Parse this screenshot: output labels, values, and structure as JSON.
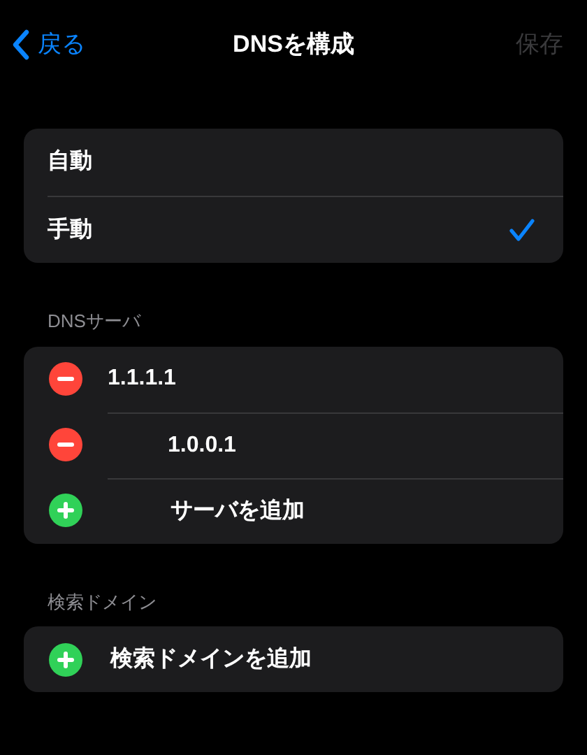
{
  "nav": {
    "back": "戻る",
    "title": "DNSを構成",
    "save": {
      "label": "保存",
      "disabled": true
    }
  },
  "mode_options": [
    {
      "label": "自動",
      "selected": false
    },
    {
      "label": "手動",
      "selected": true
    }
  ],
  "dns_servers": {
    "header": "DNSサーバ",
    "items": [
      {
        "kind": "remove",
        "label": "1.1.1.1"
      },
      {
        "kind": "remove",
        "label": "1.0.0.1"
      },
      {
        "kind": "add",
        "label": "サーバを追加"
      }
    ]
  },
  "search_domains": {
    "header": "検索ドメイン",
    "items": [
      {
        "kind": "add",
        "label": "検索ドメインを追加"
      }
    ]
  }
}
